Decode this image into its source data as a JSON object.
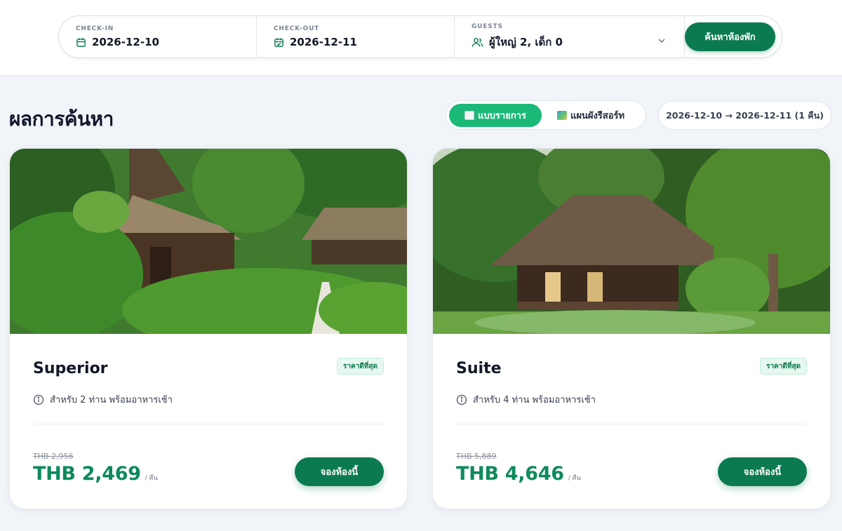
{
  "search": {
    "checkin_label": "CHECK-IN",
    "checkin_value": "2026-12-10",
    "checkout_label": "CHECK-OUT",
    "checkout_value": "2026-12-11",
    "guests_label": "GUESTS",
    "guests_value": "ผู้ใหญ่ 2, เด็ก 0",
    "search_button": "ค้นหาห้องพัก"
  },
  "results": {
    "title": "ผลการค้นหา",
    "view_list_label": "แบบรายการ",
    "view_map_label": "แผนผังรีสอร์ท",
    "date_range": "2026-12-10 → 2026-12-11 (1 คืน)"
  },
  "rooms": [
    {
      "name": "Superior",
      "badge": "ราคาดีที่สุด",
      "description": "สำหรับ 2 ท่าน พร้อมอาหารเช้า",
      "old_price": "THB 2,956",
      "price": "THB 2,469",
      "unit": "/ คืน",
      "book_label": "จองห้องนี้"
    },
    {
      "name": "Suite",
      "badge": "ราคาดีที่สุด",
      "description": "สำหรับ 4 ท่าน พร้อมอาหารเช้า",
      "old_price": "THB 5,889",
      "price": "THB 4,646",
      "unit": "/ คืน",
      "book_label": "จองห้องนี้"
    }
  ],
  "icons": {
    "calendar": "calendar-icon",
    "calendar_check": "calendar-check-icon",
    "users": "users-icon",
    "chevron": "chevron-down-icon",
    "info": "info-icon"
  },
  "colors": {
    "primary": "#0b7a50",
    "accent": "#1bb978",
    "price": "#0e8a5b",
    "page_bg": "#f1f4f8"
  }
}
